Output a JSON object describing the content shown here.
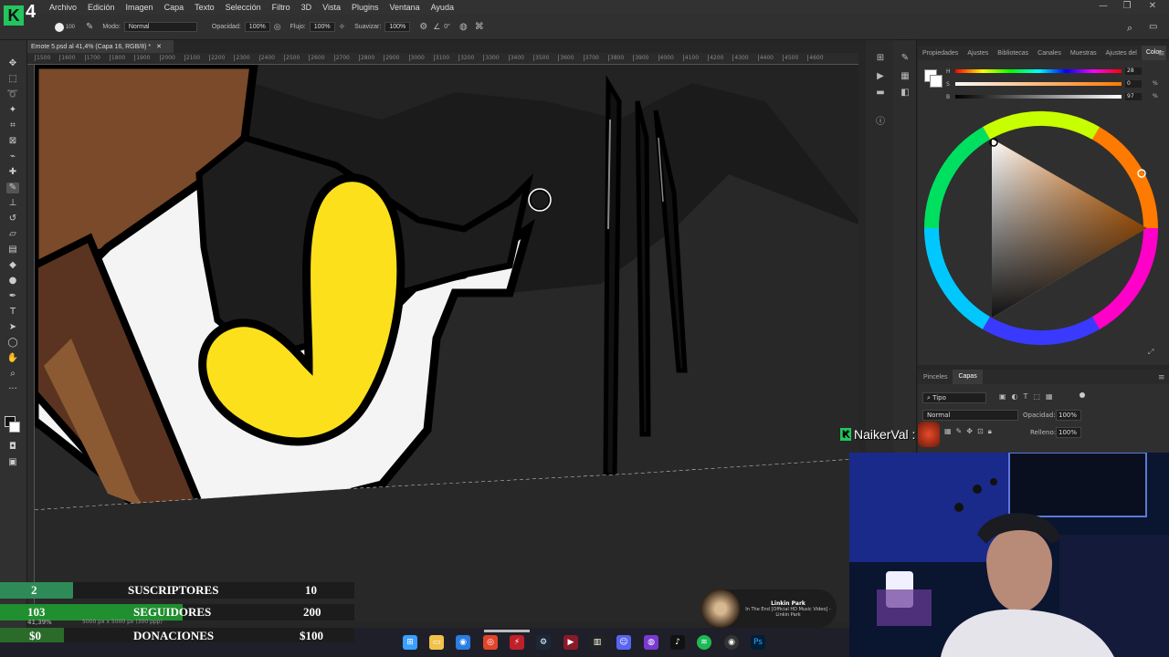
{
  "logo": {
    "letter": "K",
    "number": "4"
  },
  "menu": [
    "Archivo",
    "Edición",
    "Imagen",
    "Capa",
    "Texto",
    "Selección",
    "Filtro",
    "3D",
    "Vista",
    "Plugins",
    "Ventana",
    "Ayuda"
  ],
  "options": {
    "brush_size": "100",
    "mode_label": "Modo:",
    "mode_value": "Normal",
    "opacity_label": "Opacidad:",
    "opacity_value": "100%",
    "flow_label": "Flujo:",
    "flow_value": "100%",
    "smoothing_label": "Suavizar:",
    "smoothing_value": "100%",
    "angle_value": "0°"
  },
  "document": {
    "tab_title": "Emote 5.psd al 41,4% (Capa 16, RGB/8) *"
  },
  "ruler_ticks": [
    "1500",
    "1600",
    "1700",
    "1800",
    "1900",
    "2000",
    "2100",
    "2200",
    "2300",
    "2400",
    "2500",
    "2600",
    "2700",
    "2800",
    "2900",
    "3000",
    "3100",
    "3200",
    "3300",
    "3400",
    "3500",
    "3600",
    "3700",
    "3800",
    "3900",
    "4000",
    "4100",
    "4200",
    "4300",
    "4400",
    "4500",
    "4600"
  ],
  "status": {
    "zoom": "41,39%",
    "size": "5000 px x 5000 px (300 ppp)"
  },
  "color_panel": {
    "tabs": [
      "Propiedades",
      "Ajustes",
      "Bibliotecas",
      "Canales",
      "Muestras",
      "Ajustes del",
      "Color"
    ],
    "active_tab": "Color",
    "sliders": [
      {
        "label": "H",
        "value": "28"
      },
      {
        "label": "S",
        "value": "0"
      },
      {
        "label": "B",
        "value": "97"
      }
    ],
    "percent": "%"
  },
  "layers_panel": {
    "tabs": [
      "Pinceles",
      "Capas"
    ],
    "active_tab": "Capas",
    "filter_label": "Tipo",
    "blend_mode": "Normal",
    "opacity_label": "Opacidad:",
    "opacity_value": "100%",
    "fill_label": "Relleno:",
    "fill_value": "100%"
  },
  "stream": {
    "username": "NaikerVal :",
    "stats": [
      {
        "left": "2",
        "label": "SUSCRIPTORES",
        "right": "10",
        "color": "#2e8b57"
      },
      {
        "left": "103",
        "label": "SEGUIDORES",
        "right": "200",
        "color": "#1f8f2f"
      },
      {
        "left": "$0",
        "label": "DONACIONES",
        "right": "$100",
        "color": "#2a6b2a"
      }
    ],
    "now_playing": {
      "artist": "Linkin Park",
      "title": "In The End [Official HD Music Video] - Linkin Park"
    }
  },
  "taskbar_icons": [
    "windows-icon",
    "file-explorer-icon",
    "browser-icon",
    "opera-icon",
    "app-icon",
    "steam-icon",
    "code-icon",
    "terminal-icon",
    "discord-icon",
    "app2-icon",
    "tiktok-icon",
    "spotify-icon",
    "obs-icon",
    "photoshop-icon"
  ],
  "colors": {
    "accent_green": "#22c55e",
    "yellow": "#fde01c",
    "brown": "#7a4a2a"
  }
}
